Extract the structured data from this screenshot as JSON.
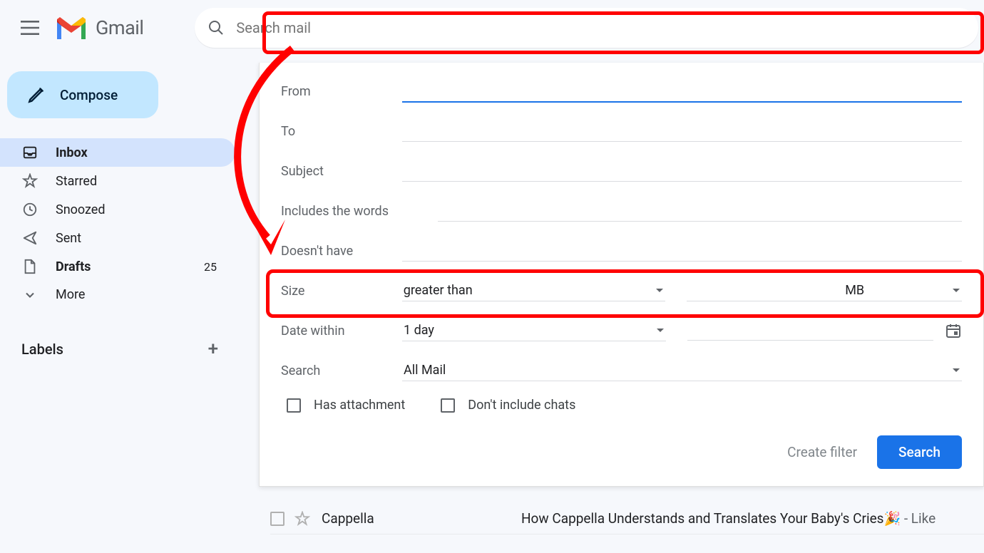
{
  "header": {
    "app_name": "Gmail",
    "search_placeholder": "Search mail"
  },
  "sidebar": {
    "compose_label": "Compose",
    "items": [
      {
        "icon": "inbox",
        "label": "Inbox",
        "active": true,
        "bold": true,
        "count": ""
      },
      {
        "icon": "star",
        "label": "Starred",
        "active": false,
        "bold": false,
        "count": ""
      },
      {
        "icon": "clock",
        "label": "Snoozed",
        "active": false,
        "bold": false,
        "count": ""
      },
      {
        "icon": "send",
        "label": "Sent",
        "active": false,
        "bold": false,
        "count": ""
      },
      {
        "icon": "file",
        "label": "Drafts",
        "active": false,
        "bold": true,
        "count": "25"
      },
      {
        "icon": "chevron-down",
        "label": "More",
        "active": false,
        "bold": false,
        "count": ""
      }
    ],
    "labels_heading": "Labels"
  },
  "filter": {
    "from_label": "From",
    "to_label": "To",
    "subject_label": "Subject",
    "includes_label": "Includes the words",
    "doesnt_have_label": "Doesn't have",
    "size_label": "Size",
    "size_operator": "greater than",
    "size_unit": "MB",
    "date_label": "Date within",
    "date_range": "1 day",
    "search_label": "Search",
    "search_scope": "All Mail",
    "has_attachment_label": "Has attachment",
    "no_chats_label": "Don't include chats",
    "create_filter_label": "Create filter",
    "search_button_label": "Search"
  },
  "mail": {
    "sender": "Cappella",
    "subject": "How Cappella Understands and Translates Your Baby's Cries🎉",
    "snippet": " - Like"
  },
  "annotations": {
    "highlight_color": "#ff0000"
  }
}
